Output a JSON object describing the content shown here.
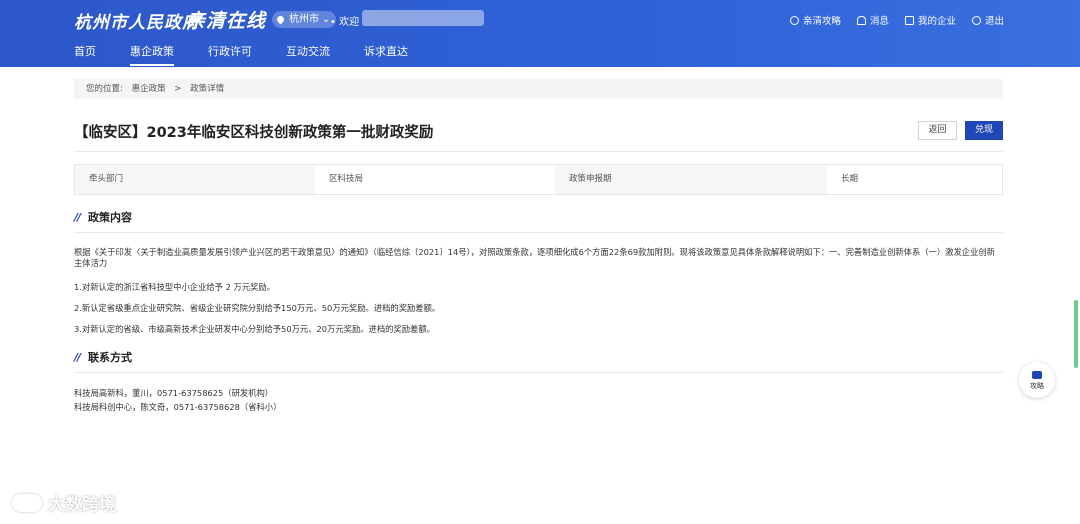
{
  "header": {
    "logo_text": "杭州市人民政府",
    "slogan": "亲清在线",
    "city_selector": "杭州市",
    "welcome": "• 欢迎",
    "top_links": [
      {
        "label": "亲清攻略",
        "icon": "help-circle-icon"
      },
      {
        "label": "消息",
        "icon": "bell-icon"
      },
      {
        "label": "我的企业",
        "icon": "building-icon"
      },
      {
        "label": "退出",
        "icon": "power-icon"
      }
    ]
  },
  "nav": {
    "tabs": [
      {
        "label": "首页"
      },
      {
        "label": "惠企政策",
        "active": true
      },
      {
        "label": "行政许可"
      },
      {
        "label": "互动交流"
      },
      {
        "label": "诉求直达"
      }
    ]
  },
  "breadcrumb": {
    "prefix": "您的位置:",
    "items": [
      "惠企政策",
      "政策详情"
    ],
    "separator": ">"
  },
  "policy": {
    "title": "【临安区】2023年临安区科技创新政策第一批财政奖励",
    "back_label": "返回",
    "claim_label": "兑现",
    "info": {
      "dept_label": "牵头部门",
      "dept_value": "区科技局",
      "period_label": "政策申报期",
      "period_value": "长期"
    }
  },
  "content": {
    "section_title": "政策内容",
    "paragraphs": [
      "根据《关于印发〈关于制造业高质量发展引领产业兴区的若干政策意见〉的通知》（临经信综〔2021〕14号），对照政策条款，逐项细化成6个方面22条69款加附则。现将该政策意见具体条款解释说明如下：一、完善制造业创新体系（一）激发企业创新主体活力",
      "1.对新认定的浙江省科技型中小企业给予 2 万元奖励。",
      "2.新认定省级重点企业研究院、省级企业研究院分别给予150万元、50万元奖励。进档的奖励差额。",
      "3.对新认定的省级、市级高新技术企业研发中心分别给予50万元、20万元奖励。进档的奖励差额。"
    ]
  },
  "contact": {
    "section_title": "联系方式",
    "lines": [
      "科技局高新科，董川，0571-63758625（研发机构）",
      "科技局科创中心，陈文奇，0571-63758628（省科小）"
    ]
  },
  "floating": {
    "label": "攻略",
    "icon": "guide-icon"
  },
  "watermark": "大数跨境",
  "colors": {
    "header_blue": "#2f5fd6",
    "primary_button": "#1f47b6"
  }
}
